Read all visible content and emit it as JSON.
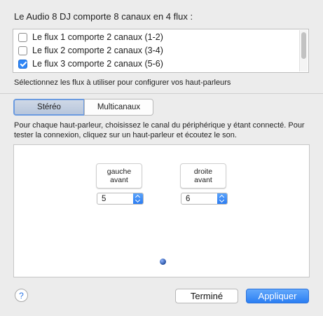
{
  "header": {
    "title": "Le Audio 8 DJ comporte 8 canaux en 4 flux :"
  },
  "streams": [
    {
      "label": "Le flux 1 comporte 2 canaux (1-2)",
      "checked": false
    },
    {
      "label": "Le flux 2 comporte 2 canaux (3-4)",
      "checked": false
    },
    {
      "label": "Le flux 3 comporte 2 canaux (5-6)",
      "checked": true
    }
  ],
  "hint": "Sélectionnez les flux à utiliser pour configurer vos haut-parleurs",
  "modes": {
    "stereo": "Stéréo",
    "multichannel": "Multicanaux",
    "selected": "stereo"
  },
  "description": "Pour chaque haut-parleur, choisissez le canal du périphérique y étant connecté. Pour tester la connexion, cliquez sur un haut-parleur et écoutez le son.",
  "speakers": {
    "left": {
      "line1": "gauche",
      "line2": "avant",
      "channel": "5"
    },
    "right": {
      "line1": "droite",
      "line2": "avant",
      "channel": "6"
    }
  },
  "footer": {
    "help_glyph": "?",
    "done_label": "Terminé",
    "apply_label": "Appliquer"
  },
  "colors": {
    "accent": "#2b7ff3",
    "background": "#ececec"
  }
}
